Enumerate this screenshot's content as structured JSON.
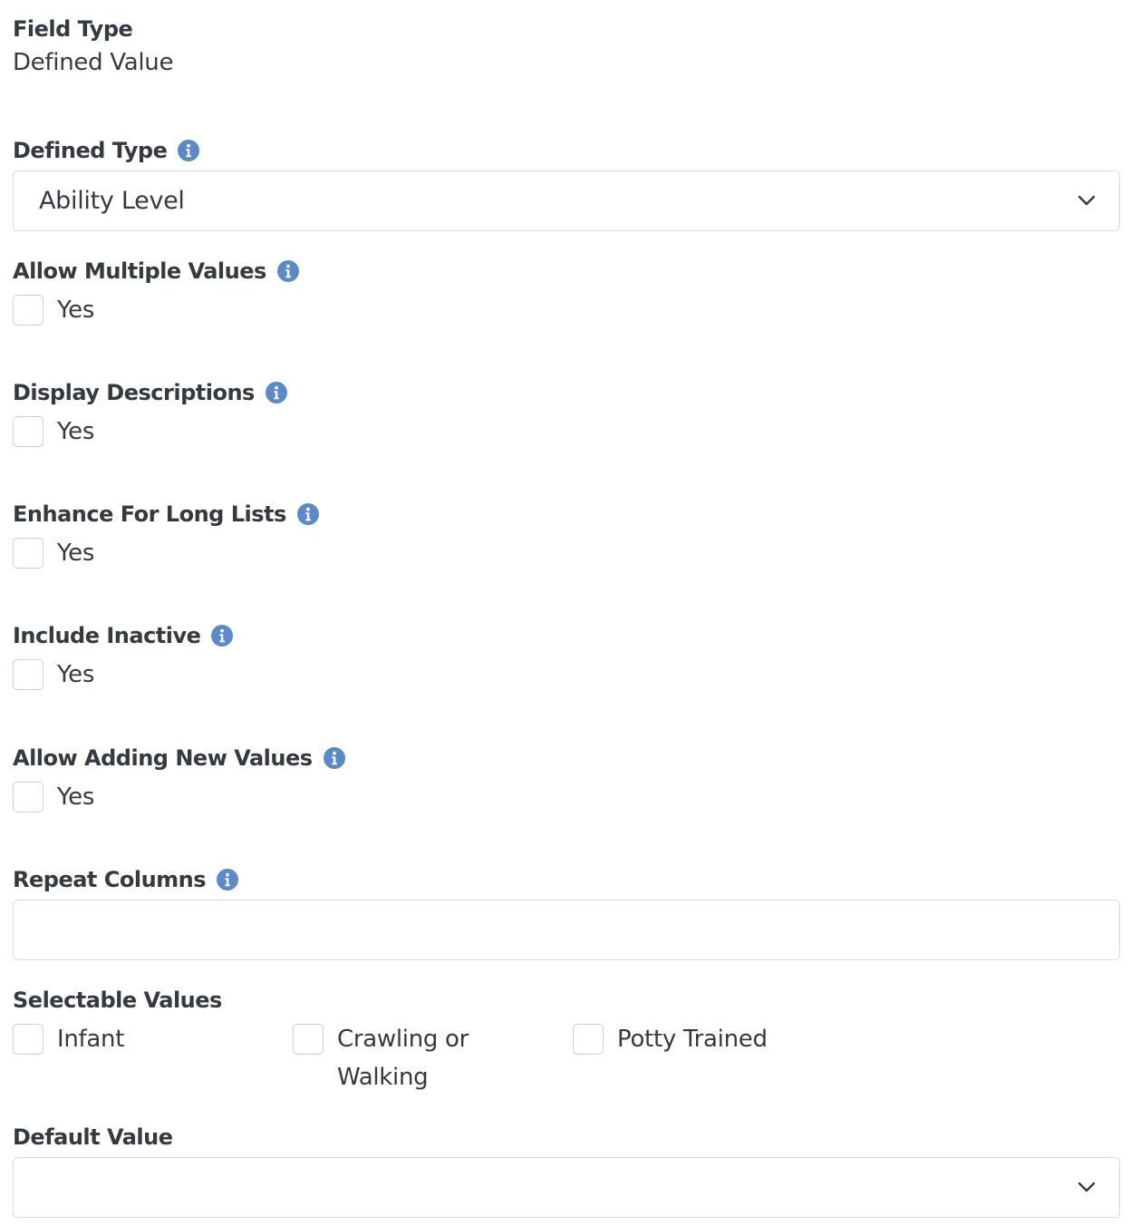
{
  "field_type": {
    "label": "Field Type",
    "value": "Defined Value"
  },
  "defined_type": {
    "label": "Defined Type",
    "selected": "Ability Level"
  },
  "allow_multiple": {
    "label": "Allow Multiple Values",
    "option": "Yes"
  },
  "display_descriptions": {
    "label": "Display Descriptions",
    "option": "Yes"
  },
  "enhance_long_lists": {
    "label": "Enhance For Long Lists",
    "option": "Yes"
  },
  "include_inactive": {
    "label": "Include Inactive",
    "option": "Yes"
  },
  "allow_adding": {
    "label": "Allow Adding New Values",
    "option": "Yes"
  },
  "repeat_columns": {
    "label": "Repeat Columns",
    "value": ""
  },
  "selectable_values": {
    "label": "Selectable Values",
    "options": [
      "Infant",
      "Crawling or Walking",
      "Potty Trained"
    ]
  },
  "default_value": {
    "label": "Default Value",
    "selected": ""
  },
  "colors": {
    "info_icon": "#5b8ac6",
    "border": "#dcdcdc",
    "text": "#343a40"
  },
  "icons": {
    "info": "info-circle-icon",
    "chevron": "chevron-down-icon"
  }
}
